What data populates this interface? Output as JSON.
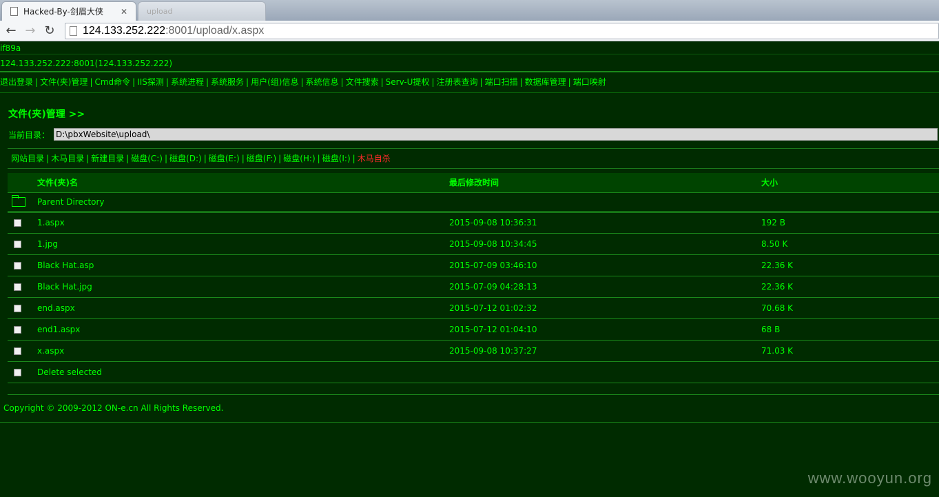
{
  "browser": {
    "tabs": [
      {
        "title": "Hacked-By-剑眉大侠",
        "close": "✕"
      },
      {
        "title": "upload"
      }
    ],
    "url_host": "124.133.252.222",
    "url_rest": ":8001/upload/x.aspx"
  },
  "shell": {
    "id_line": "if89a",
    "host_line": "124.133.252.222:8001(124.133.252.222)",
    "menu": [
      "退出登录",
      "文件(夹)管理",
      "Cmd命令",
      "IIS探测",
      "系统进程",
      "系统服务",
      "用户(组)信息",
      "系统信息",
      "文件搜索",
      "Serv-U提权",
      "注册表查询",
      "端口扫描",
      "数据库管理",
      "端口映射"
    ],
    "section_title": "文件(夹)管理 >>",
    "current_dir_label": "当前目录：",
    "current_dir_value": "D:\\pbxWebsite\\upload\\",
    "drives": [
      "网站目录",
      "木马目录",
      "新建目录",
      "磁盘(C:)",
      "磁盘(D:)",
      "磁盘(E:)",
      "磁盘(F:)",
      "磁盘(H:)",
      "磁盘(I:)"
    ],
    "kill_self": "木马自杀",
    "table": {
      "headers": {
        "name": "文件(夹)名",
        "modified": "最后修改时间",
        "size": "大小"
      },
      "parent": "Parent Directory",
      "rows": [
        {
          "name": "1.aspx",
          "modified": "2015-09-08 10:36:31",
          "size": "192 B"
        },
        {
          "name": "1.jpg",
          "modified": "2015-09-08 10:34:45",
          "size": "8.50 K"
        },
        {
          "name": "Black Hat.asp",
          "modified": "2015-07-09 03:46:10",
          "size": "22.36 K"
        },
        {
          "name": "Black Hat.jpg",
          "modified": "2015-07-09 04:28:13",
          "size": "22.36 K"
        },
        {
          "name": "end.aspx",
          "modified": "2015-07-12 01:02:32",
          "size": "70.68 K"
        },
        {
          "name": "end1.aspx",
          "modified": "2015-07-12 01:04:10",
          "size": "68 B"
        },
        {
          "name": "x.aspx",
          "modified": "2015-09-08 10:37:27",
          "size": "71.03 K"
        }
      ],
      "delete_selected": "Delete selected"
    },
    "footer": "Copyright © 2009-2012 ON-e.cn All Rights Reserved."
  },
  "watermark": "www.wooyun.org",
  "icons": {
    "back": "←",
    "forward": "→",
    "reload": "↻"
  },
  "colors": {
    "background": "#002b00",
    "text": "#00ff00",
    "danger": "#ff2a2a"
  }
}
